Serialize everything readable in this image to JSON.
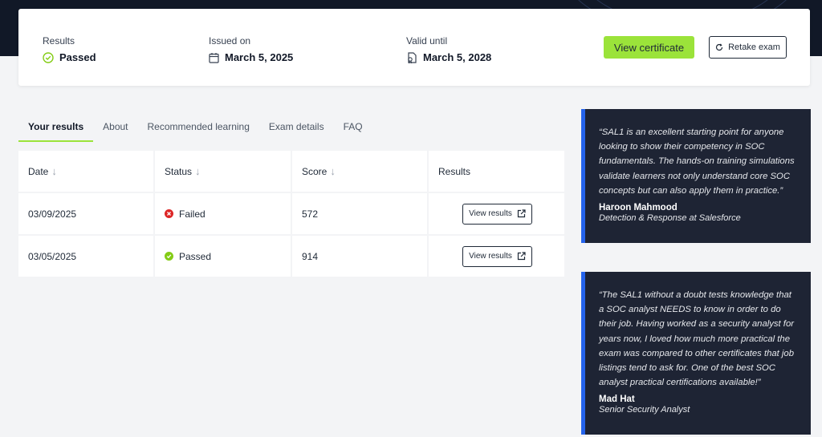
{
  "summary": {
    "results_label": "Results",
    "results_value": "Passed",
    "issued_label": "Issued on",
    "issued_value": "March 5, 2025",
    "valid_label": "Valid until",
    "valid_value": "March 5, 2028",
    "view_certificate": "View certificate",
    "retake_exam": "Retake exam"
  },
  "tabs": [
    {
      "label": "Your results",
      "active": true
    },
    {
      "label": "About"
    },
    {
      "label": "Recommended learning"
    },
    {
      "label": "Exam details"
    },
    {
      "label": "FAQ"
    }
  ],
  "table": {
    "headers": [
      "Date",
      "Status",
      "Score",
      "Results"
    ],
    "rows": [
      {
        "date": "03/09/2025",
        "status": "Failed",
        "score": "572",
        "action": "View results"
      },
      {
        "date": "03/05/2025",
        "status": "Passed",
        "score": "914",
        "action": "View results"
      }
    ]
  },
  "testimonials": [
    {
      "quote": "“SAL1 is an excellent starting point for anyone looking to show their competency in SOC fundamentals. The hands-on training simulations validate learners not only understand core SOC concepts but can also apply them in practice.”",
      "author": "Haroon Mahmood",
      "role": "Detection & Response at Salesforce"
    },
    {
      "quote": "“The SAL1 without a doubt tests knowledge that a SOC analyst NEEDS to know in order to do their job. Having worked as a security analyst for years now, I loved how much more practical the exam was compared to other certificates that job listings tend to ask for. One of the best SOC analyst practical certifications available!”",
      "author": "Mad Hat",
      "role": "Senior Security Analyst"
    }
  ],
  "colors": {
    "accent": "#9be33a",
    "failed": "#dc2626",
    "passed": "#84cc16",
    "quote_bg": "#1e2434",
    "quote_border": "#2563eb"
  },
  "icons": {
    "results": "check-circle-icon",
    "issued": "calendar-icon",
    "valid": "certificate-icon",
    "retake": "refresh-icon",
    "sort": "arrow-down-icon",
    "external": "external-link-icon"
  }
}
